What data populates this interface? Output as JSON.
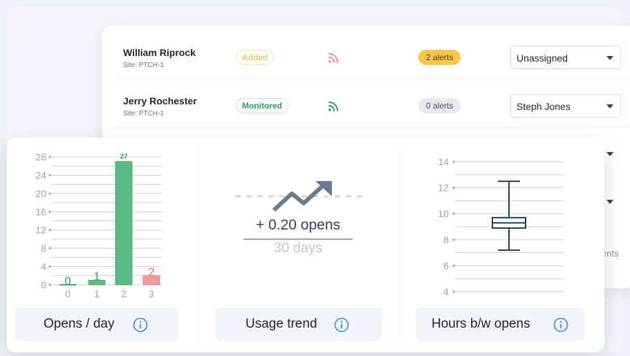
{
  "patients": [
    {
      "name": "William Riprock",
      "site": "Site:  PTCH-1",
      "status": "Added",
      "alerts": "2 alerts",
      "assignee": "Unassigned"
    },
    {
      "name": "Jerry Rochester",
      "site": "Site:  PTCH-1",
      "status": "Monitored",
      "alerts": "0 alerts",
      "assignee": "Steph Jones"
    }
  ],
  "cut_off_text": "ents",
  "widgets": {
    "opens_per_day": {
      "label": "Opens / day"
    },
    "usage_trend": {
      "label": "Usage trend",
      "value": "+ 0.20 opens",
      "period": "30 days"
    },
    "hours_between_opens": {
      "label": "Hours b/w opens"
    }
  },
  "colors": {
    "bar_green": "#5cbb85",
    "bar_red": "#ef9b9b",
    "alert_yellow": "#f6c54a",
    "monitored_green": "#2f9a55"
  },
  "icons": {
    "signal": "wifi-signal-icon",
    "info": "info-icon",
    "trend": "trend-arrow-icon",
    "dropdown": "caret-down-icon"
  },
  "chart_data": [
    {
      "type": "bar",
      "x": [
        0,
        1,
        2,
        3
      ],
      "values": [
        0,
        1,
        27,
        2
      ],
      "data_labels": [
        "0",
        "1",
        "27",
        "2"
      ],
      "x_ticks": [
        "0",
        "1",
        "2",
        "3"
      ],
      "y_ticks": [
        "0",
        "4",
        "8",
        "12",
        "16",
        "20",
        "24",
        "28"
      ],
      "ylim": [
        0,
        28
      ],
      "grid": true,
      "title": "",
      "xlabel": "",
      "ylabel": ""
    },
    {
      "type": "box",
      "y_ticks": [
        "4",
        "6",
        "8",
        "10",
        "12",
        "14"
      ],
      "ylim": [
        4,
        14
      ],
      "min": 7.2,
      "q1": 8.9,
      "median": 9.3,
      "q3": 9.7,
      "max": 12.5,
      "grid": true,
      "title": "",
      "xlabel": "",
      "ylabel": ""
    }
  ]
}
